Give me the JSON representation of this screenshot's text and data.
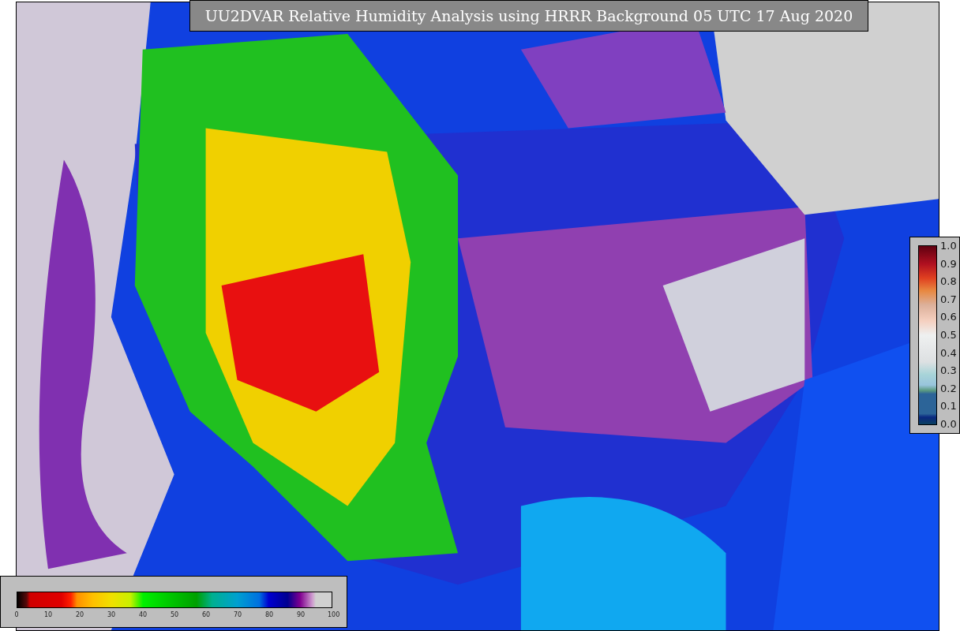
{
  "title": "UU2DVAR Relative Humidity Analysis using HRRR Background 05 UTC 17 Aug 2020",
  "observation_colorbar": {
    "ticks": [
      "1.0",
      "0.9",
      "0.8",
      "0.7",
      "0.6",
      "0.5",
      "0.4",
      "0.3",
      "0.2",
      "0.1",
      "0.0"
    ]
  },
  "analysis_colorbar": {
    "ticks": [
      "0",
      "10",
      "20",
      "30",
      "40",
      "50",
      "60",
      "70",
      "80",
      "90",
      "100"
    ]
  }
}
